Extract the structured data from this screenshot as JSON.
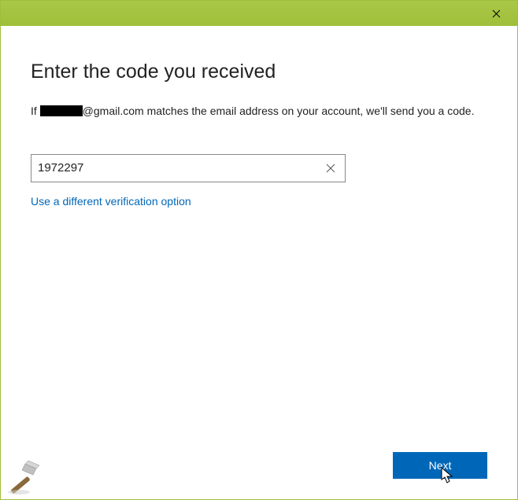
{
  "heading": "Enter the code you received",
  "description_prefix": "If ",
  "description_email_domain": "@gmail.com",
  "description_suffix": " matches the email address on your account, we'll send you a code.",
  "code_value": "1972297",
  "alt_link": "Use a different verification option",
  "next_label": "Next"
}
